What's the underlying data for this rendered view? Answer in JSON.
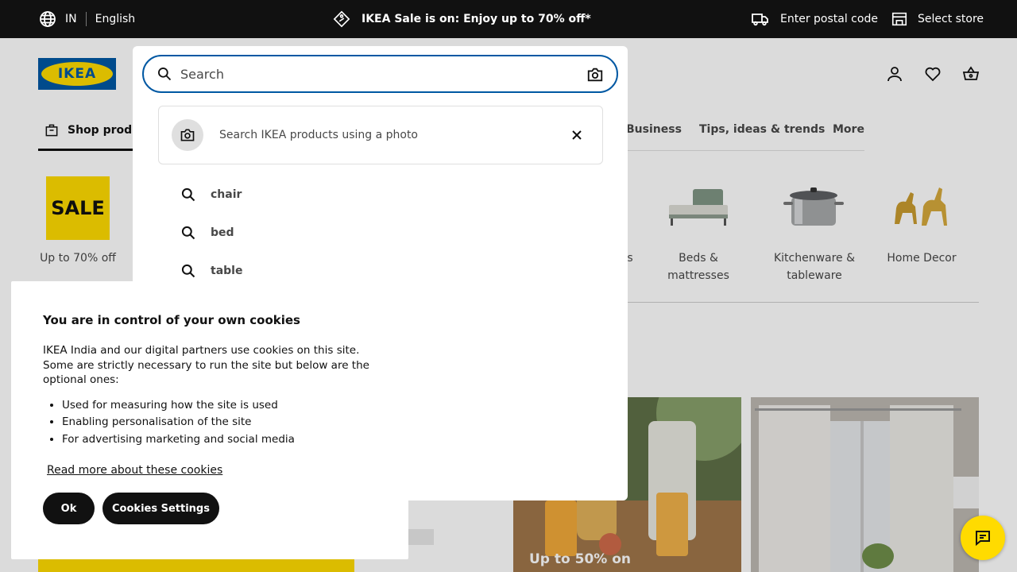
{
  "topbar": {
    "country": "IN",
    "language": "English",
    "promo": "IKEA Sale is on: Enjoy up to 70% off*",
    "postal": "Enter postal code",
    "store": "Select store"
  },
  "header": {
    "logo_text": "IKEA",
    "nav": {
      "shop": "Shop products",
      "business": "Business",
      "tips": "Tips, ideas & trends",
      "more": "More"
    }
  },
  "categories": {
    "sale_badge": "SALE",
    "sale_label": "Up to 70% off",
    "partial_label": "s",
    "beds": "Beds & mattresses",
    "kitchen_line1": "Kitchenware &",
    "kitchen_line2": "tableware",
    "decor": "Home Decor"
  },
  "promo": {
    "caption": "Up to 50% on"
  },
  "search": {
    "placeholder": "Search",
    "photo_prompt": "Search IKEA products using a photo",
    "suggestions": [
      "chair",
      "bed",
      "table"
    ]
  },
  "cookie": {
    "title": "You are in control of your own cookies",
    "body": "IKEA India and our digital partners use cookies on this site. Some are strictly necessary to run the site but below are the optional ones:",
    "bullets": [
      "Used for measuring how the site is used",
      "Enabling personalisation of the site",
      "For advertising marketing and social media"
    ],
    "link": "Read more about these cookies",
    "ok": "Ok",
    "settings": "Cookies Settings"
  },
  "colors": {
    "brand_blue": "#0058a3",
    "brand_yellow": "#ffdb00",
    "dark": "#111111"
  },
  "icons": [
    "globe-icon",
    "price-tag-icon",
    "truck-icon",
    "store-icon",
    "user-icon",
    "heart-icon",
    "basket-icon",
    "search-icon",
    "camera-icon",
    "close-icon",
    "chat-icon"
  ]
}
